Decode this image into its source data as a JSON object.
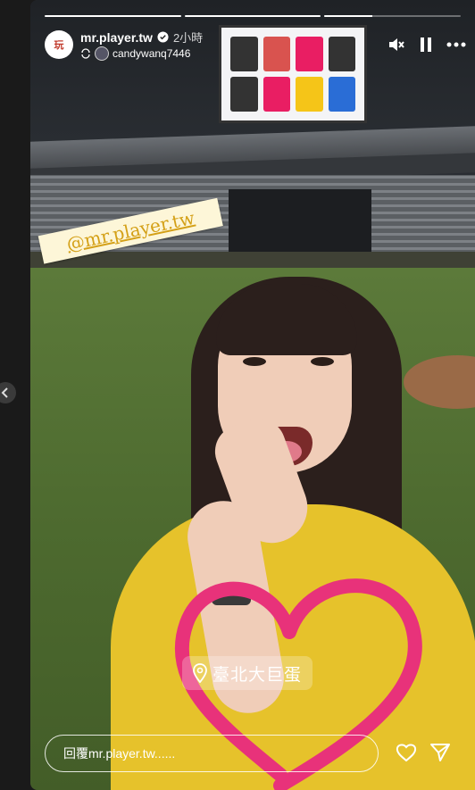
{
  "story": {
    "progress_segments": [
      1.0,
      1.0,
      0.35
    ],
    "user": {
      "avatar_text": "玩",
      "username": "mr.player.tw",
      "time": "2小時",
      "reposted_from": "candywanq7446"
    },
    "mention_sticker": "@mr.player.tw",
    "location_sticker": "臺北大巨蛋",
    "reply_placeholder": "回覆mr.player.tw......"
  },
  "colors": {
    "heart": "#e8327a",
    "mention_text": "#d4a017",
    "mention_bg": "#fdf6d8"
  },
  "icons": [
    "chevron-left-icon",
    "verified-icon",
    "repost-icon",
    "mute-icon",
    "pause-icon",
    "more-icon",
    "location-pin-icon",
    "heart-icon",
    "send-icon"
  ]
}
